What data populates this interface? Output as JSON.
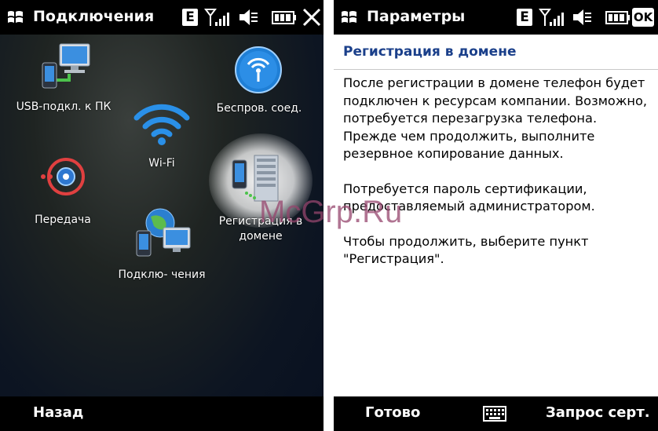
{
  "left_screen": {
    "title": "Подключения",
    "status": {
      "network": "E"
    },
    "items": [
      {
        "id": "usb",
        "label": "USB-подкл. к ПК"
      },
      {
        "id": "wireless",
        "label": "Беспров. соед."
      },
      {
        "id": "wifi",
        "label": "Wi-Fi"
      },
      {
        "id": "beam",
        "label": "Передача"
      },
      {
        "id": "domain",
        "label_line1": "Регистрация в",
        "label_line2": "домене"
      },
      {
        "id": "connections",
        "label": "Подклю- чения"
      }
    ],
    "softkey_left": "Назад"
  },
  "right_screen": {
    "title": "Параметры",
    "status": {
      "network": "E",
      "ok": "OK"
    },
    "section_title": "Регистрация в домене",
    "paragraphs": [
      "После регистрации в домене телефон будет подключен к ресурсам компании. Возможно, потребуется перезагрузка телефона. Прежде чем продолжить, выполните резервное копирование данных.",
      "Потребуется пароль сертификации, предоставляемый администратором.",
      "Чтобы продолжить, выберите пункт \"Регистрация\"."
    ],
    "softkey_left": "Готово",
    "softkey_right": "Запрос серт."
  },
  "watermark": "McGrp.Ru",
  "colors": {
    "titlebar_bg": "#000000",
    "section_title": "#1a3f8a",
    "accent_blue": "#1e7fd6"
  }
}
